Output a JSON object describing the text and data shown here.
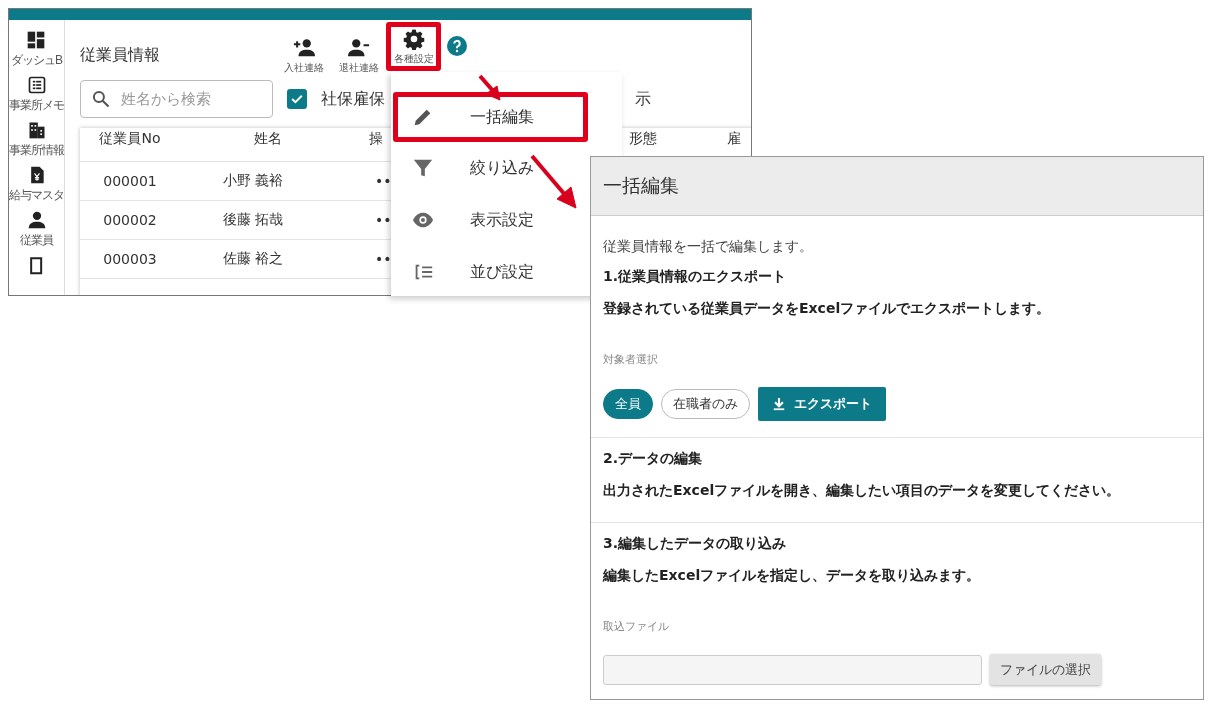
{
  "screen": {
    "sidebar": [
      {
        "kind": "dashboard",
        "label": "ダッシュB"
      },
      {
        "kind": "memo",
        "label": "事業所メモ"
      },
      {
        "kind": "office",
        "label": "事業所情報"
      },
      {
        "kind": "payroll",
        "label": "給与マスタ"
      },
      {
        "kind": "person",
        "label": "従業員"
      },
      {
        "kind": "document"
      }
    ],
    "title": "従業員情報",
    "toolbar": [
      {
        "kind": "add-person",
        "label": "入社連絡",
        "highlighted": false
      },
      {
        "kind": "remove-person",
        "label": "退社連絡",
        "highlighted": false
      },
      {
        "kind": "gear",
        "label": "各種設定",
        "highlighted": true
      }
    ],
    "search": {
      "placeholder": "姓名から検索"
    },
    "filter": {
      "label": "社保雇保",
      "checked": true
    },
    "filter_tail": "示",
    "table": {
      "columns": [
        "従業員No",
        "姓名",
        "操",
        "形態",
        "雇"
      ],
      "rows": [
        {
          "no": "000001",
          "name": "小野 義裕",
          "action": "••"
        },
        {
          "no": "000002",
          "name": "後藤 拓哉",
          "action": "••"
        },
        {
          "no": "000003",
          "name": "佐藤 裕之",
          "action": "••"
        }
      ]
    }
  },
  "menu": {
    "items": [
      {
        "kind": "edit",
        "label": "一括編集",
        "highlighted": true
      },
      {
        "kind": "filter",
        "label": "絞り込み",
        "highlighted": false
      },
      {
        "kind": "view",
        "label": "表示設定",
        "highlighted": false
      },
      {
        "kind": "sort",
        "label": "並び設定",
        "highlighted": false
      }
    ]
  },
  "dialog": {
    "title": "一括編集",
    "intro": "従業員情報を一括で編集します。",
    "sections": [
      {
        "kind": "export",
        "heading": "1.従業員情報のエクスポート",
        "text": "登録されている従業員データをExcelファイルでエクスポートします。",
        "field_label": "対象者選択",
        "options": [
          {
            "label": "全員",
            "selected": true
          },
          {
            "label": "在職者のみ",
            "selected": false
          }
        ],
        "button": "エクスポート"
      },
      {
        "kind": "info",
        "heading": "2.データの編集",
        "text": "出力されたExcelファイルを開き、編集したい項目のデータを変更してください。"
      },
      {
        "kind": "import",
        "heading": "3.編集したデータの取り込み",
        "text": "編集したExcelファイルを指定し、データを取り込みます。",
        "field_label": "取込ファイル",
        "button": "ファイルの選択"
      }
    ]
  }
}
